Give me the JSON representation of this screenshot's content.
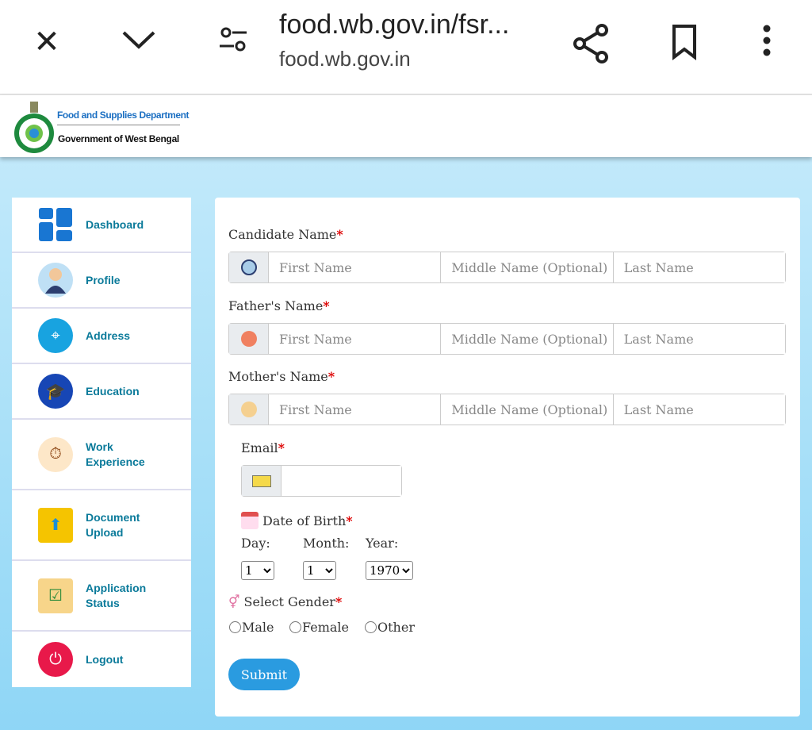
{
  "browser": {
    "title": "food.wb.gov.in/fsr...",
    "domain": "food.wb.gov.in",
    "icons": [
      "close-icon",
      "chevron-down-icon",
      "tune-icon",
      "share-icon",
      "bookmark-icon",
      "more-vert-icon"
    ]
  },
  "site": {
    "department": "Food and Supplies Department",
    "government": "Government of West Bengal"
  },
  "sidebar": {
    "items": [
      {
        "label": "Dashboard",
        "icon": "dashboard-icon",
        "color": "#1976d2"
      },
      {
        "label": "Profile",
        "icon": "user-icon",
        "color": "#7fb3d9"
      },
      {
        "label": "Address",
        "icon": "location-icon",
        "color": "#18a3e0"
      },
      {
        "label": "Education",
        "icon": "graduation-cap-icon",
        "color": "#1746b5"
      },
      {
        "label": "Work\nExperience",
        "icon": "briefcase-clock-icon",
        "color": "#f0a030"
      },
      {
        "label": "Document\nUpload",
        "icon": "upload-icon",
        "color": "#f5c400"
      },
      {
        "label": "Application\nStatus",
        "icon": "clipboard-icon",
        "color": "#f0b040"
      },
      {
        "label": "Logout",
        "icon": "power-icon",
        "color": "#e8194a"
      }
    ]
  },
  "form": {
    "candidate": {
      "label": "Candidate Name",
      "first": "First Name",
      "middle": "Middle Name (Optional)",
      "last": "Last Name"
    },
    "father": {
      "label": "Father's Name",
      "first": "First Name",
      "middle": "Middle Name (Optional)",
      "last": "Last Name"
    },
    "mother": {
      "label": "Mother's Name",
      "first": "First Name",
      "middle": "Middle Name (Optional)",
      "last": "Last Name"
    },
    "email": {
      "label": "Email",
      "value": ""
    },
    "dob": {
      "label": "Date of Birth",
      "day_label": "Day:",
      "month_label": "Month:",
      "year_label": "Year:",
      "day": "1",
      "month": "1",
      "year": "1970"
    },
    "gender": {
      "label": "Select Gender",
      "options": [
        "Male",
        "Female",
        "Other"
      ]
    },
    "required_mark": "*",
    "submit": "Submit"
  }
}
